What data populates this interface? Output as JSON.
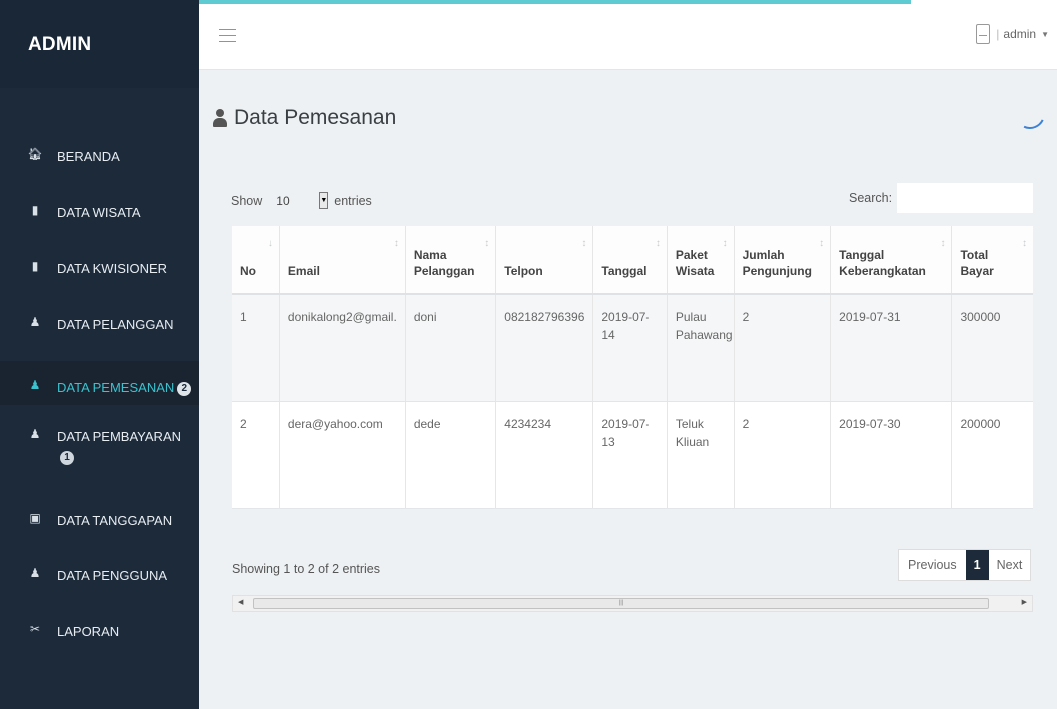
{
  "sidebar": {
    "brand": "ADMIN",
    "items": [
      {
        "label": "BERANDA",
        "icon": "home-icon",
        "glyph": "🏠︎",
        "badge": ""
      },
      {
        "label": "DATA WISATA",
        "icon": "file-icon",
        "glyph": "▮",
        "badge": ""
      },
      {
        "label": "DATA KWISIONER",
        "icon": "file-icon",
        "glyph": "▮",
        "badge": ""
      },
      {
        "label": "DATA PELANGGAN",
        "icon": "user-icon",
        "glyph": "♟",
        "badge": ""
      },
      {
        "label": "DATA PEMESANAN",
        "icon": "user-icon",
        "glyph": "♟",
        "badge": "2"
      },
      {
        "label": "DATA PEMBAYARAN",
        "icon": "user-icon",
        "glyph": "♟",
        "badge": "1"
      },
      {
        "label": "DATA TANGGAPAN",
        "icon": "calendar-icon",
        "glyph": "▣",
        "badge": ""
      },
      {
        "label": "DATA PENGGUNA",
        "icon": "user-icon",
        "glyph": "♟",
        "badge": ""
      },
      {
        "label": "LAPORAN",
        "icon": "tools-icon",
        "glyph": "✂",
        "badge": ""
      }
    ],
    "active_index": 4
  },
  "topbar": {
    "user": "admin"
  },
  "page": {
    "title": "Data Pemesanan"
  },
  "table_controls": {
    "show_label": "Show",
    "entries_value": "10",
    "entries_label": "entries",
    "search_label": "Search:",
    "search_value": ""
  },
  "table": {
    "columns": [
      {
        "label": "No",
        "sort": "↓"
      },
      {
        "label": "Email",
        "sort": "↕"
      },
      {
        "label": "Nama Pelanggan",
        "sort": "↕"
      },
      {
        "label": "Telpon",
        "sort": "↕"
      },
      {
        "label": "Tanggal",
        "sort": "↕"
      },
      {
        "label": "Paket Wisata",
        "sort": "↕"
      },
      {
        "label": "Jumlah Pengunjung",
        "sort": "↕"
      },
      {
        "label": "Tanggal Keberangkatan",
        "sort": "↕"
      },
      {
        "label": "Total Bayar",
        "sort": "↕"
      }
    ],
    "rows": [
      [
        "1",
        "donikalong2@gmail.",
        "doni",
        "082182796396",
        "2019-07-14",
        "Pulau Pahawang",
        "2",
        "2019-07-31",
        "300000"
      ],
      [
        "2",
        "dera@yahoo.com",
        "dede",
        "4234234",
        "2019-07-13",
        "Teluk Kliuan",
        "2",
        "2019-07-30",
        "200000"
      ]
    ]
  },
  "footer": {
    "info": "Showing 1 to 2 of 2 entries",
    "previous": "Previous",
    "current_page": "1",
    "next": "Next"
  },
  "colors": {
    "sidebar_bg": "#1c2a3a",
    "accent": "#3ac3ce",
    "topline": "#5ecad1",
    "spinner": "#3b82d8"
  }
}
